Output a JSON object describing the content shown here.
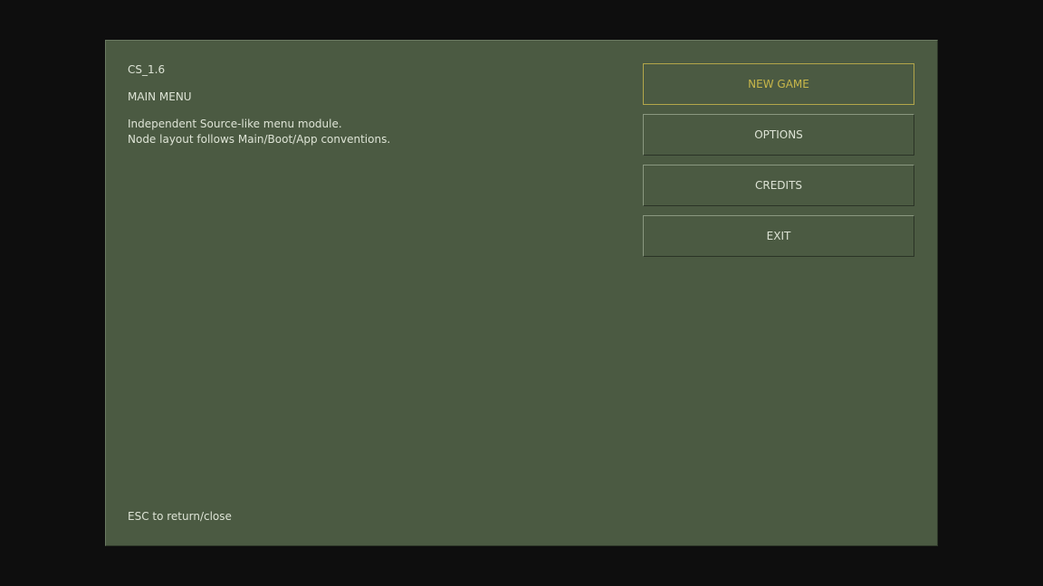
{
  "panel": {
    "game_title": "CS_1.6",
    "menu_title": "MAIN MENU",
    "description": [
      "Independent Source-like menu module.",
      "Node layout follows Main/Boot/App conventions."
    ],
    "hint": "ESC to return/close"
  },
  "menu": {
    "items": [
      {
        "label": "NEW GAME",
        "selected": true
      },
      {
        "label": "OPTIONS",
        "selected": false
      },
      {
        "label": "CREDITS",
        "selected": false
      },
      {
        "label": "EXIT",
        "selected": false
      }
    ]
  },
  "colors": {
    "background": "#0e0e0e",
    "panel": "#4b5a42",
    "text": "#dde3d5",
    "accent": "#c8b74a"
  }
}
